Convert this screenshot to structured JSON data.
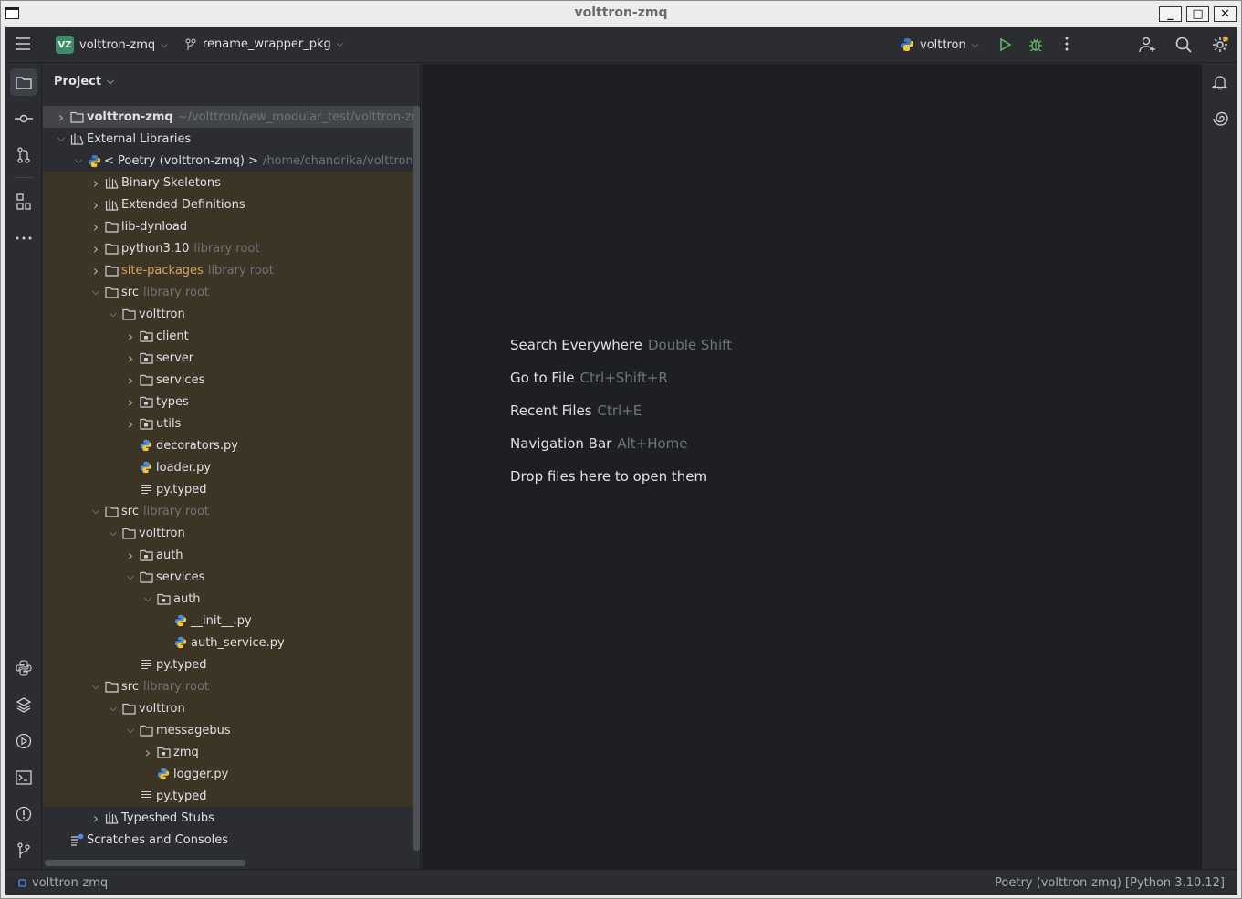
{
  "window": {
    "title": "volttron-zmq",
    "min_label": "_",
    "max_label": "□",
    "close_label": "✕"
  },
  "topbar": {
    "project_badge": "VZ",
    "project_name": "volttron-zmq",
    "branch": "rename_wrapper_pkg",
    "run_config": "volttron"
  },
  "project_panel": {
    "title": "Project"
  },
  "tree": [
    {
      "label": "volttron-zmq",
      "hint": "~/volttron/new_modular_test/volttron-zmq",
      "depth": 0,
      "arrow": "right",
      "icon": "folder-icon",
      "style": "bold",
      "sel": true
    },
    {
      "label": "External Libraries",
      "depth": 0,
      "arrow": "down",
      "icon": "library-icon"
    },
    {
      "label": "< Poetry (volttron-zmq) >",
      "hint": "/home/chandrika/volttron/new_modular_test/volttron-zmq",
      "depth": 1,
      "arrow": "down",
      "icon": "python-icon"
    },
    {
      "label": "Binary Skeletons",
      "depth": 2,
      "arrow": "right",
      "icon": "library-icon",
      "lib": true
    },
    {
      "label": "Extended Definitions",
      "depth": 2,
      "arrow": "right",
      "icon": "library-icon",
      "lib": true
    },
    {
      "label": "lib-dynload",
      "depth": 2,
      "arrow": "right",
      "icon": "folder-icon",
      "lib": true
    },
    {
      "label": "python3.10",
      "hint": "library root",
      "depth": 2,
      "arrow": "right",
      "icon": "folder-icon",
      "lib": true
    },
    {
      "label": "site-packages",
      "hint": "library root",
      "depth": 2,
      "arrow": "right",
      "icon": "folder-icon",
      "lib": true,
      "style": "orange"
    },
    {
      "label": "src",
      "hint": "library root",
      "depth": 2,
      "arrow": "down",
      "icon": "folder-icon",
      "lib": true
    },
    {
      "label": "volttron",
      "depth": 3,
      "arrow": "down",
      "icon": "folder-icon",
      "lib": true
    },
    {
      "label": "client",
      "depth": 4,
      "arrow": "right",
      "icon": "package-icon",
      "lib": true
    },
    {
      "label": "server",
      "depth": 4,
      "arrow": "right",
      "icon": "package-icon",
      "lib": true
    },
    {
      "label": "services",
      "depth": 4,
      "arrow": "right",
      "icon": "folder-icon",
      "lib": true
    },
    {
      "label": "types",
      "depth": 4,
      "arrow": "right",
      "icon": "package-icon",
      "lib": true
    },
    {
      "label": "utils",
      "depth": 4,
      "arrow": "right",
      "icon": "package-icon",
      "lib": true
    },
    {
      "label": "decorators.py",
      "depth": 4,
      "arrow": "",
      "icon": "python-file-icon",
      "lib": true
    },
    {
      "label": "loader.py",
      "depth": 4,
      "arrow": "",
      "icon": "python-file-icon",
      "lib": true
    },
    {
      "label": "py.typed",
      "depth": 4,
      "arrow": "",
      "icon": "text-file-icon",
      "lib": true
    },
    {
      "label": "src",
      "hint": "library root",
      "depth": 2,
      "arrow": "down",
      "icon": "folder-icon",
      "lib": true
    },
    {
      "label": "volttron",
      "depth": 3,
      "arrow": "down",
      "icon": "folder-icon",
      "lib": true
    },
    {
      "label": "auth",
      "depth": 4,
      "arrow": "right",
      "icon": "package-icon",
      "lib": true
    },
    {
      "label": "services",
      "depth": 4,
      "arrow": "down",
      "icon": "folder-icon",
      "lib": true
    },
    {
      "label": "auth",
      "depth": 5,
      "arrow": "down",
      "icon": "package-icon",
      "lib": true
    },
    {
      "label": "__init__.py",
      "depth": 6,
      "arrow": "",
      "icon": "python-file-icon",
      "lib": true
    },
    {
      "label": "auth_service.py",
      "depth": 6,
      "arrow": "",
      "icon": "python-file-icon",
      "lib": true
    },
    {
      "label": "py.typed",
      "depth": 4,
      "arrow": "",
      "icon": "text-file-icon",
      "lib": true
    },
    {
      "label": "src",
      "hint": "library root",
      "depth": 2,
      "arrow": "down",
      "icon": "folder-icon",
      "lib": true
    },
    {
      "label": "volttron",
      "depth": 3,
      "arrow": "down",
      "icon": "folder-icon",
      "lib": true
    },
    {
      "label": "messagebus",
      "depth": 4,
      "arrow": "down",
      "icon": "folder-icon",
      "lib": true
    },
    {
      "label": "zmq",
      "depth": 5,
      "arrow": "right",
      "icon": "package-icon",
      "lib": true
    },
    {
      "label": "logger.py",
      "depth": 5,
      "arrow": "",
      "icon": "python-file-icon",
      "lib": true
    },
    {
      "label": "py.typed",
      "depth": 4,
      "arrow": "",
      "icon": "text-file-icon",
      "lib": true
    },
    {
      "label": "Typeshed Stubs",
      "depth": 2,
      "arrow": "right",
      "icon": "library-icon"
    },
    {
      "label": "Scratches and Consoles",
      "depth": 0,
      "arrow": "",
      "icon": "scratches-icon"
    }
  ],
  "editor_tips": [
    {
      "label": "Search Everywhere",
      "key": "Double Shift"
    },
    {
      "label": "Go to File",
      "key": "Ctrl+Shift+R"
    },
    {
      "label": "Recent Files",
      "key": "Ctrl+E"
    },
    {
      "label": "Navigation Bar",
      "key": "Alt+Home"
    },
    {
      "label": "Drop files here to open them",
      "key": ""
    }
  ],
  "statusbar": {
    "left": "volttron-zmq",
    "right": "Poetry (volttron-zmq) [Python 3.10.12]"
  }
}
